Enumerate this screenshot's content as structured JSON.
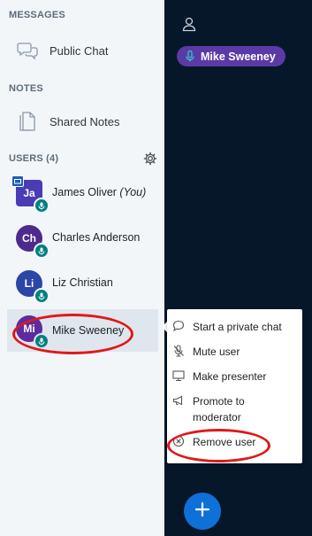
{
  "colors": {
    "sidebar_bg": "#f3f6f9",
    "main_bg": "#06172a",
    "selected_row": "#dfe6ee",
    "mic_badge": "#008081",
    "talking_pill": "#5b3aa6",
    "fab": "#0f70d7",
    "annotation_ring": "#e01818"
  },
  "sidebar": {
    "messages_title": "MESSAGES",
    "public_chat": {
      "label": "Public Chat",
      "icon": "chat-bubbles-icon"
    },
    "notes_title": "NOTES",
    "shared_notes": {
      "label": "Shared Notes",
      "icon": "document-icon"
    },
    "users_title": "USERS (4)",
    "settings_icon": "gear-icon",
    "users": [
      {
        "initials": "Ja",
        "name": "James Oliver",
        "suffix": "(You)",
        "avatar_color": "#4a3cb5",
        "presenter": true
      },
      {
        "initials": "Ch",
        "name": "Charles Anderson",
        "avatar_color": "#4d2b8c",
        "presenter": false
      },
      {
        "initials": "Li",
        "name": "Liz Christian",
        "avatar_color": "#2b46a6",
        "presenter": false
      },
      {
        "initials": "Mi",
        "name": "Mike Sweeney",
        "avatar_color": "#5e2ba0",
        "presenter": false
      }
    ]
  },
  "main": {
    "user_icon": "user-outline-icon",
    "talking_indicator": {
      "name": "Mike Sweeney",
      "icon": "microphone-icon"
    },
    "action_button_icon": "plus-icon"
  },
  "context_menu": {
    "items": [
      {
        "label": "Start a private chat",
        "icon": "chat-icon"
      },
      {
        "label": "Mute user",
        "icon": "mute-icon"
      },
      {
        "label": "Make presenter",
        "icon": "presenter-icon"
      },
      {
        "label": "Promote to moderator",
        "icon": "megaphone-icon"
      },
      {
        "label": "Remove user",
        "icon": "circle-x-icon"
      }
    ]
  }
}
